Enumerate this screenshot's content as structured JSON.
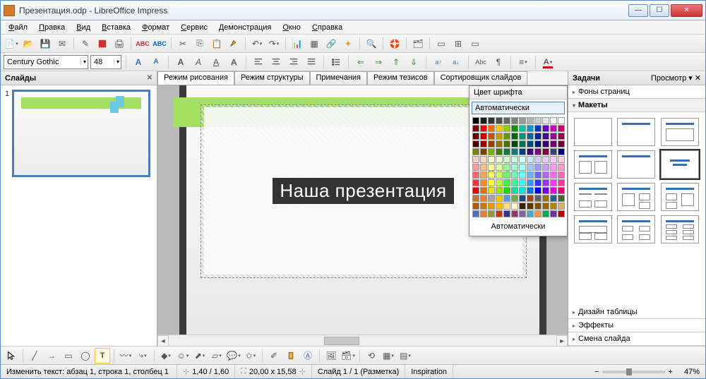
{
  "title": "Презентация.odp - LibreOffice Impress",
  "menus": [
    "Файл",
    "Правка",
    "Вид",
    "Вставка",
    "Формат",
    "Сервис",
    "Демонстрация",
    "Окно",
    "Справка"
  ],
  "font": {
    "name": "Century Gothic",
    "size": "48"
  },
  "panels": {
    "slides": "Слайды",
    "tasks": "Задачи",
    "view": "Просмотр"
  },
  "view_tabs": [
    "Режим рисования",
    "Режим структуры",
    "Примечания",
    "Режим тезисов",
    "Сортировщик слайдов"
  ],
  "slide_text": "Наша презентация",
  "slide_number": "1",
  "color_popup": {
    "title": "Цвет шрифта",
    "auto": "Автоматически",
    "footer": "Автоматически"
  },
  "task_sections": {
    "bg": "Фоны страниц",
    "layouts": "Макеты",
    "table": "Дизайн таблицы",
    "effects": "Эффекты",
    "transition": "Смена слайда"
  },
  "status": {
    "edit": "Изменить текст: абзац 1, строка 1, столбец 1",
    "pos": "1,40 / 1,60",
    "size": "20,00 x 15,58",
    "slide": "Слайд 1 / 1 (Разметка)",
    "master": "Inspiration",
    "zoom": "47%"
  },
  "palette": [
    "#000000",
    "#1a1a1a",
    "#333333",
    "#4d4d4d",
    "#666666",
    "#808080",
    "#999999",
    "#b3b3b3",
    "#cccccc",
    "#e6e6e6",
    "#f2f2f2",
    "#ffffff",
    "#7f0000",
    "#ff0000",
    "#ff6600",
    "#ffcc00",
    "#99cc00",
    "#009900",
    "#00cc99",
    "#0099cc",
    "#0033cc",
    "#6600cc",
    "#cc00cc",
    "#cc0066",
    "#660000",
    "#cc0000",
    "#cc5200",
    "#cc9900",
    "#669900",
    "#006600",
    "#009973",
    "#006699",
    "#002699",
    "#4d0099",
    "#990099",
    "#99004d",
    "#4d0000",
    "#990000",
    "#993d00",
    "#997300",
    "#4d7300",
    "#004d00",
    "#007356",
    "#004d73",
    "#001d73",
    "#390073",
    "#730073",
    "#730039",
    "#7f7f00",
    "#7f3f00",
    "#7fb000",
    "#3f7f00",
    "#007f3f",
    "#007f7f",
    "#003f7f",
    "#3f007f",
    "#7f007f",
    "#7f003f",
    "#3f3f7f",
    "#00007f",
    "#ffcccc",
    "#ffd9b3",
    "#ffffcc",
    "#e6ffcc",
    "#ccffcc",
    "#ccffe6",
    "#ccffff",
    "#cce6ff",
    "#ccccff",
    "#e6ccff",
    "#ffccff",
    "#ffcce6",
    "#ff9999",
    "#ffbf80",
    "#ffff99",
    "#d9ff99",
    "#99ff99",
    "#99ffcc",
    "#99ffff",
    "#99ccff",
    "#9999ff",
    "#cc99ff",
    "#ff99ff",
    "#ff99cc",
    "#ff6666",
    "#ffa64d",
    "#ffff66",
    "#ccff66",
    "#66ff66",
    "#66ffb3",
    "#66ffff",
    "#66b3ff",
    "#6666ff",
    "#b366ff",
    "#ff66ff",
    "#ff66b3",
    "#ff3333",
    "#ff8c1a",
    "#ffff33",
    "#bfff33",
    "#33ff33",
    "#33ff99",
    "#33ffff",
    "#3399ff",
    "#3333ff",
    "#9933ff",
    "#ff33ff",
    "#ff3399",
    "#e60000",
    "#e67300",
    "#e6e600",
    "#99e600",
    "#00e600",
    "#00e699",
    "#00e6e6",
    "#0073e6",
    "#0000e6",
    "#7300e6",
    "#e600e6",
    "#e60073",
    "#bf7830",
    "#ed7d31",
    "#a5a5a5",
    "#ffc000",
    "#5b9bd5",
    "#70ad47",
    "#264478",
    "#9e480e",
    "#636363",
    "#997300",
    "#255e91",
    "#43682b",
    "#b35900",
    "#cc7a00",
    "#e69900",
    "#ffbf00",
    "#ffe680",
    "#fff2cc",
    "#402000",
    "#593900",
    "#7f5200",
    "#996300",
    "#b38600",
    "#d9b36c",
    "#4472c4",
    "#ed7d31",
    "#999933",
    "#cc3300",
    "#333399",
    "#993366",
    "#8064a2",
    "#4bacc6",
    "#f79646",
    "#00b050",
    "#7030a0",
    "#c00000"
  ]
}
